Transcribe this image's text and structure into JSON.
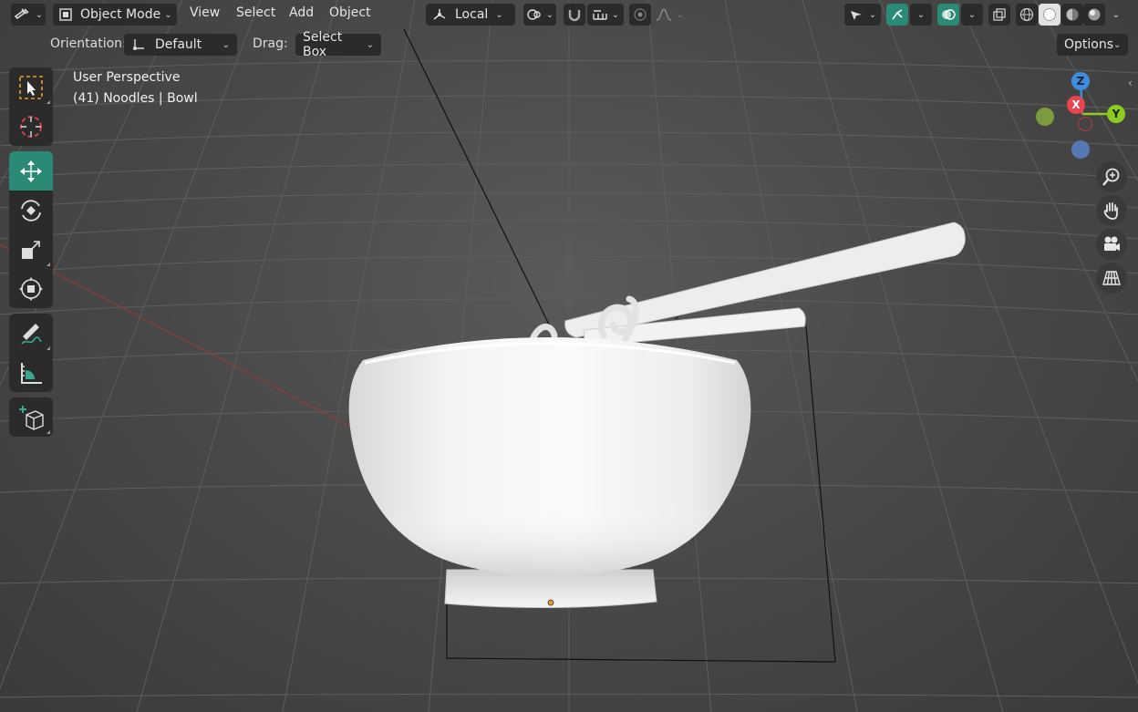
{
  "header": {
    "mode_label": "Object Mode",
    "menus": [
      "View",
      "Select",
      "Add",
      "Object"
    ],
    "transform_pivot_label": "Local"
  },
  "tool_settings": {
    "orientation_label": "Orientation:",
    "orientation_value": "Default",
    "drag_label": "Drag:",
    "drag_value": "Select Box",
    "options_label": "Options"
  },
  "viewport": {
    "view_name": "User Perspective",
    "object_info": "(41) Noodles | Bowl"
  },
  "gizmo": {
    "z_label": "Z",
    "x_label": "X",
    "y_label": "Y"
  },
  "colors": {
    "accent": "#2a8a76",
    "axis_x": "#e8434e",
    "axis_y": "#8ccc1f",
    "axis_z": "#3f8de2",
    "axis_neg_y": "#7f9a3c",
    "axis_neg_z": "#5679b4",
    "origin": "#e79a2e"
  }
}
